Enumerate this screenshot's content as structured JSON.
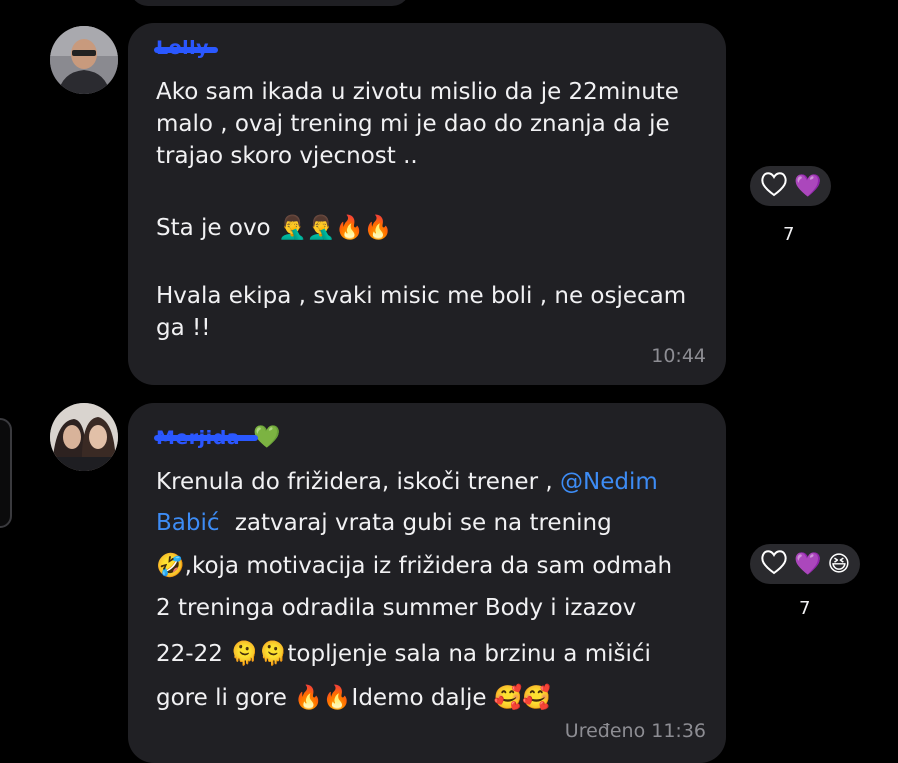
{
  "messages": [
    {
      "sender": "Lolly",
      "lines": [
        "Ako sam ikada u zivotu mislio da je 22minute",
        "malo , ovaj trening mi je dao do znanja da je",
        "trajao skoro vjecnost ..",
        "",
        "Sta je ovo 🤦‍♂️🤦‍♂️🔥🔥",
        "",
        "Hvala ekipa , svaki misic me boli , ne osjecam",
        "ga !!"
      ],
      "time": "10:44",
      "reactions": {
        "count": "7",
        "emojis": [
          "💜"
        ]
      }
    },
    {
      "sender": "Merjida",
      "sender_emoji": "💚",
      "line1_prefix": "Krenula do frižidera, iskoči trener ,",
      "mention_part1": "@Nedim",
      "mention_part2": "Babić",
      "line2_suffix": "zatvaraj vrata gubi se na trening",
      "lines_rest": [
        "🤣,koja motivacija iz frižidera da sam odmah",
        "2 treninga odradila summer Body i izazov",
        "22-22 🫠🫠topljenje sala na brzinu a mišići",
        "gore li gore 🔥🔥Idemo dalje 🥰🥰"
      ],
      "time": "Uređeno 11:36",
      "reactions": {
        "count": "7",
        "emojis": [
          "💜",
          "😆"
        ]
      }
    }
  ],
  "icons": {
    "react": "heart-outline-icon"
  },
  "colors": {
    "bubble": "#202024",
    "mention": "#3d8cf5",
    "background": "#000000"
  }
}
